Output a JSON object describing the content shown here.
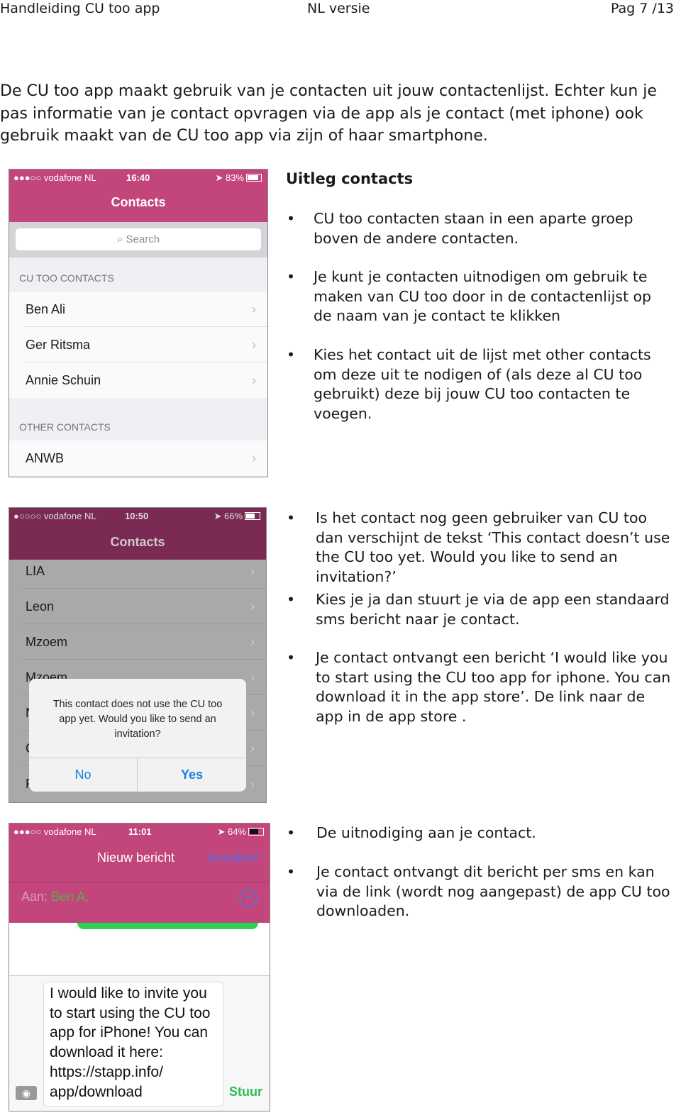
{
  "header": {
    "left": "Handleiding CU too app",
    "center": "NL versie",
    "right": "Pag 7 /13"
  },
  "intro": "De CU too app maakt gebruik van je contacten uit jouw contactenlijst. Echter kun je pas informatie van je contact opvragen via de app als je contact (met iphone) ook gebruik maakt van de CU too app via zijn of haar smartphone.",
  "phone1": {
    "carrier": "●●●○○ vodafone NL",
    "time": "16:40",
    "battery": "83%",
    "battery_level": 0.83,
    "title": "Contacts",
    "search_placeholder": "Search",
    "section1": "CU TOO CONTACTS",
    "cu_contacts": [
      "Ben Ali",
      "Ger Ritsma",
      "Annie Schuin"
    ],
    "section2": "OTHER CONTACTS",
    "other_contacts": [
      "ANWB"
    ],
    "accent": "#c2457c"
  },
  "section1": {
    "title": "Uitleg contacts",
    "bullets": [
      "CU too contacten staan in een aparte groep boven de andere contacten.",
      "Je kunt je contacten uitnodigen om gebruik te maken van CU too door in de contactenlijst op de naam van je contact te klikken",
      "Kies het contact uit de lijst met other contacts om deze uit te nodigen of (als deze al CU too gebruikt) deze bij jouw CU too contacten te voegen."
    ]
  },
  "phone2": {
    "carrier": "●○○○○ vodafone NL",
    "time": "10:50",
    "battery": "66%",
    "battery_level": 0.66,
    "title": "Contacts",
    "contacts": [
      "LIA",
      "Leon",
      "Mzoem",
      "Mzoem",
      "N",
      "C",
      "F"
    ],
    "dialog": {
      "message": "This contact does not use the CU too app yet. Would you like to send an invitation?",
      "no": "No",
      "yes": "Yes"
    }
  },
  "section2": {
    "bullets": [
      "Is het contact nog geen gebruiker van CU too dan verschijnt de tekst ‘This contact doesn’t use the CU too yet. Would you like to send an invitation?’",
      "Kies je ja dan stuurt je via de app een standaard sms bericht naar je contact.",
      "Je contact ontvangt een bericht ‘I would like you to start using the CU too app for iphone. You can download it in the app store’.  De link naar de app in de app store ."
    ]
  },
  "phone3": {
    "carrier": "●●●○○ vodafone NL",
    "time": "11:01",
    "battery": "64%",
    "battery_level": 0.64,
    "title": "Nieuw bericht",
    "cancel": "Annuleer",
    "to_label": "Aan:",
    "recipient": "Ben A,",
    "message": "I would like to invite you to start using the CU too app for iPhone! You can download it here: https://stapp.info/ app/download",
    "send": "Stuur"
  },
  "section3": {
    "bullets": [
      "De uitnodiging aan je contact.",
      "Je contact ontvangt dit bericht per sms en kan via de link (wordt nog aangepast) de app CU too downloaden."
    ]
  }
}
